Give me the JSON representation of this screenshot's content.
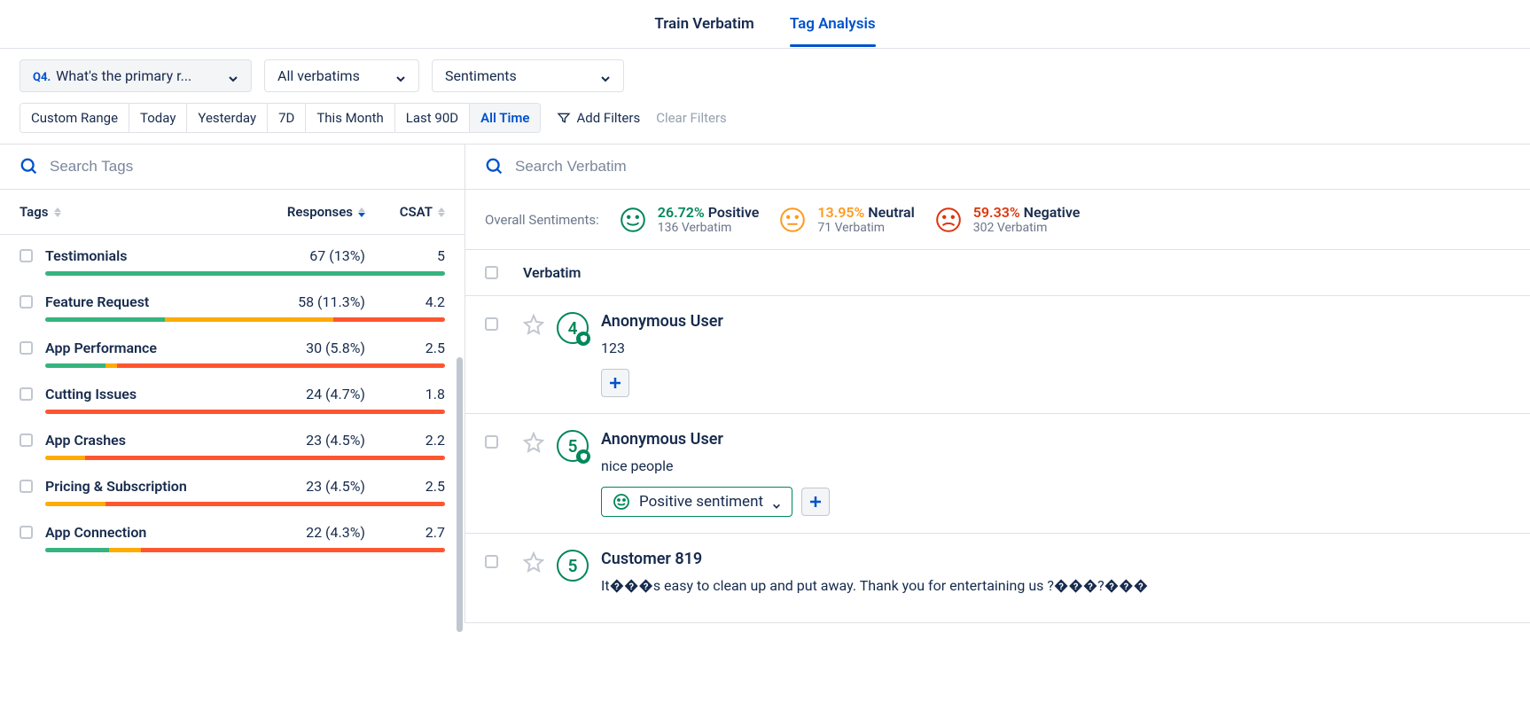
{
  "tabs": {
    "train": "Train Verbatim",
    "analysis": "Tag Analysis"
  },
  "dropdowns": {
    "question_prefix": "Q4.",
    "question_label": "What's the primary r...",
    "verbatims": "All verbatims",
    "sentiments": "Sentiments"
  },
  "ranges": [
    "Custom Range",
    "Today",
    "Yesterday",
    "7D",
    "This Month",
    "Last 90D",
    "All Time"
  ],
  "range_active": "All Time",
  "add_filters": "Add Filters",
  "clear_filters": "Clear Filters",
  "left": {
    "search_placeholder": "Search Tags",
    "headers": {
      "tags": "Tags",
      "responses": "Responses",
      "csat": "CSAT"
    },
    "rows": [
      {
        "name": "Testimonials",
        "responses": "67 (13%)",
        "csat": "5",
        "g": 100,
        "y": 0,
        "r": 0
      },
      {
        "name": "Feature Request",
        "responses": "58 (11.3%)",
        "csat": "4.2",
        "g": 30,
        "y": 42,
        "r": 28
      },
      {
        "name": "App Performance",
        "responses": "30 (5.8%)",
        "csat": "2.5",
        "g": 15,
        "y": 3,
        "r": 82
      },
      {
        "name": "Cutting Issues",
        "responses": "24 (4.7%)",
        "csat": "1.8",
        "g": 0,
        "y": 0,
        "r": 100
      },
      {
        "name": "App Crashes",
        "responses": "23 (4.5%)",
        "csat": "2.2",
        "g": 0,
        "y": 10,
        "r": 90
      },
      {
        "name": "Pricing & Subscription",
        "responses": "23 (4.5%)",
        "csat": "2.5",
        "g": 0,
        "y": 15,
        "r": 85
      },
      {
        "name": "App Connection",
        "responses": "22 (4.3%)",
        "csat": "2.7",
        "g": 16,
        "y": 8,
        "r": 76
      }
    ]
  },
  "right": {
    "search_placeholder": "Search Verbatim",
    "overall_label": "Overall Sentiments:",
    "sentiments": {
      "pos": {
        "pct": "26.72%",
        "word": "Positive",
        "sub": "136 Verbatim"
      },
      "neu": {
        "pct": "13.95%",
        "word": "Neutral",
        "sub": "71 Verbatim"
      },
      "neg": {
        "pct": "59.33%",
        "word": "Negative",
        "sub": "302 Verbatim"
      }
    },
    "verbatim_header": "Verbatim",
    "positive_chip": "Positive sentiment",
    "items": [
      {
        "score": "4",
        "user": "Anonymous User",
        "text": "123",
        "has_chip": false,
        "has_mini": true
      },
      {
        "score": "5",
        "user": "Anonymous User",
        "text": "nice people",
        "has_chip": true,
        "has_mini": true
      },
      {
        "score": "5",
        "user": "Customer 819",
        "text": "It���s easy to clean up and put away. Thank you for entertaining us ?���?���",
        "has_chip": false,
        "has_mini": false
      }
    ]
  }
}
